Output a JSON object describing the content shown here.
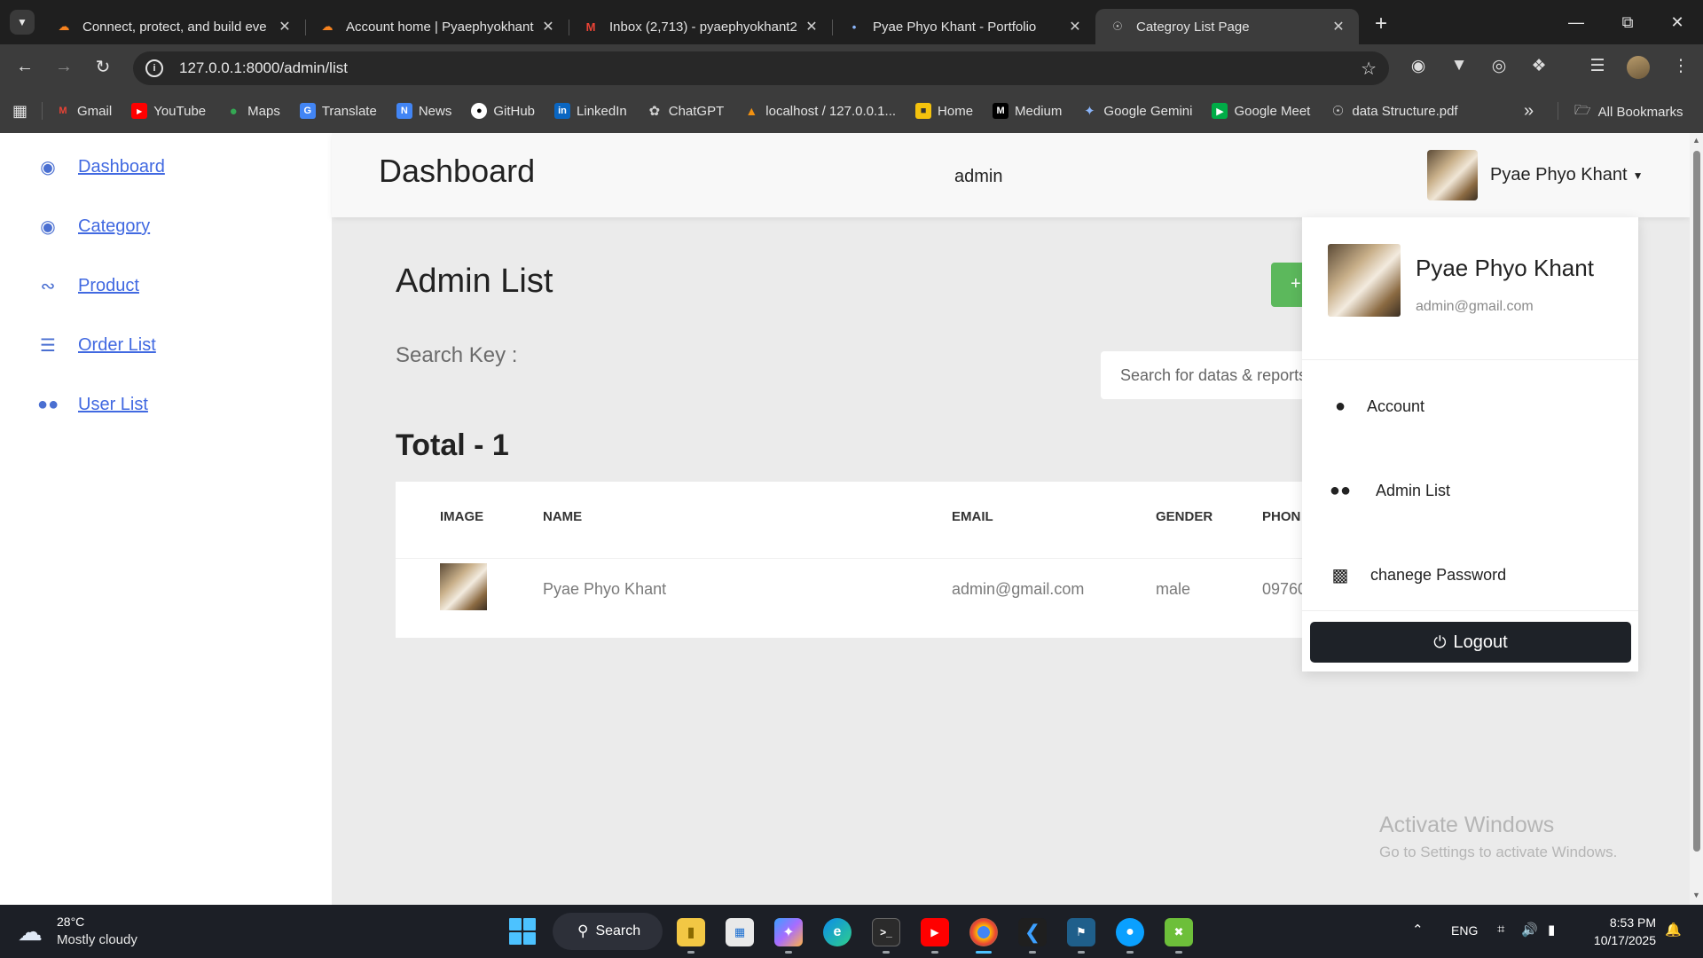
{
  "browser": {
    "tabs": [
      {
        "title": "Connect, protect, and build eve",
        "favicon": "cloudflare-icon",
        "active": false
      },
      {
        "title": "Account home | Pyaephyokhant",
        "favicon": "cloudflare-icon",
        "active": false
      },
      {
        "title": "Inbox (2,713) - pyaephyokhant2",
        "favicon": "gmail-icon",
        "active": false
      },
      {
        "title": "Pyae Phyo Khant - Portfolio",
        "favicon": "portfolio-icon",
        "active": false
      },
      {
        "title": "Categroy List Page",
        "favicon": "globe-icon",
        "active": true
      }
    ],
    "url": "127.0.0.1:8000/admin/list",
    "bookmarks": [
      {
        "label": "Gmail",
        "icon": "gmail-icon",
        "color": "#ea4335"
      },
      {
        "label": "YouTube",
        "icon": "youtube-icon",
        "color": "#ff0000"
      },
      {
        "label": "Maps",
        "icon": "maps-icon",
        "color": "#34a853"
      },
      {
        "label": "Translate",
        "icon": "translate-icon",
        "color": "#4285f4"
      },
      {
        "label": "News",
        "icon": "news-icon",
        "color": "#4285f4"
      },
      {
        "label": "GitHub",
        "icon": "github-icon",
        "color": "#ffffff"
      },
      {
        "label": "LinkedIn",
        "icon": "linkedin-icon",
        "color": "#0a66c2"
      },
      {
        "label": "ChatGPT",
        "icon": "chatgpt-icon",
        "color": "#cfcfcf"
      },
      {
        "label": "localhost / 127.0.0.1...",
        "icon": "phpmyadmin-icon",
        "color": "#f29111"
      },
      {
        "label": "Home",
        "icon": "home-icon",
        "color": "#f4c20d"
      },
      {
        "label": "Medium",
        "icon": "medium-icon",
        "color": "#000000"
      },
      {
        "label": "Google Gemini",
        "icon": "gemini-icon",
        "color": "#8ab4f8"
      },
      {
        "label": "Google Meet",
        "icon": "meet-icon",
        "color": "#00ac47"
      },
      {
        "label": "data Structure.pdf",
        "icon": "globe-icon",
        "color": "#cfcfcf"
      }
    ],
    "all_bookmarks": "All Bookmarks"
  },
  "sidebar": {
    "items": [
      {
        "label": "Dashboard",
        "icon": "palette-icon"
      },
      {
        "label": "Category",
        "icon": "palette-icon"
      },
      {
        "label": "Product",
        "icon": "feed-icon"
      },
      {
        "label": "Order List",
        "icon": "list-check-icon"
      },
      {
        "label": "User List",
        "icon": "users-icon"
      }
    ]
  },
  "topbar": {
    "title": "Dashboard",
    "role": "admin",
    "user_name": "Pyae Phyo Khant"
  },
  "main": {
    "title": "Admin List",
    "add_button": "+",
    "search_label": "Search Key :",
    "search_placeholder": "Search for datas & reports",
    "total": "Total - 1",
    "columns": [
      "IMAGE",
      "NAME",
      "EMAIL",
      "GENDER",
      "PHON"
    ],
    "rows": [
      {
        "name": "Pyae Phyo Khant",
        "email": "admin@gmail.com",
        "gender": "male",
        "phone": "09760"
      }
    ]
  },
  "dropdown": {
    "name": "Pyae Phyo Khant",
    "email": "admin@gmail.com",
    "items": [
      {
        "label": "Account",
        "icon": "user-icon"
      },
      {
        "label": "Admin List",
        "icon": "users-icon"
      },
      {
        "label": "chanege Password",
        "icon": "lock-icon"
      }
    ],
    "logout": "Logout"
  },
  "watermark": {
    "line1": "Activate Windows",
    "line2": "Go to Settings to activate Windows."
  },
  "taskbar": {
    "temperature": "28°C",
    "weather": "Mostly cloudy",
    "search": "Search",
    "language": "ENG",
    "time": "8:53 PM",
    "date": "10/17/2025"
  }
}
